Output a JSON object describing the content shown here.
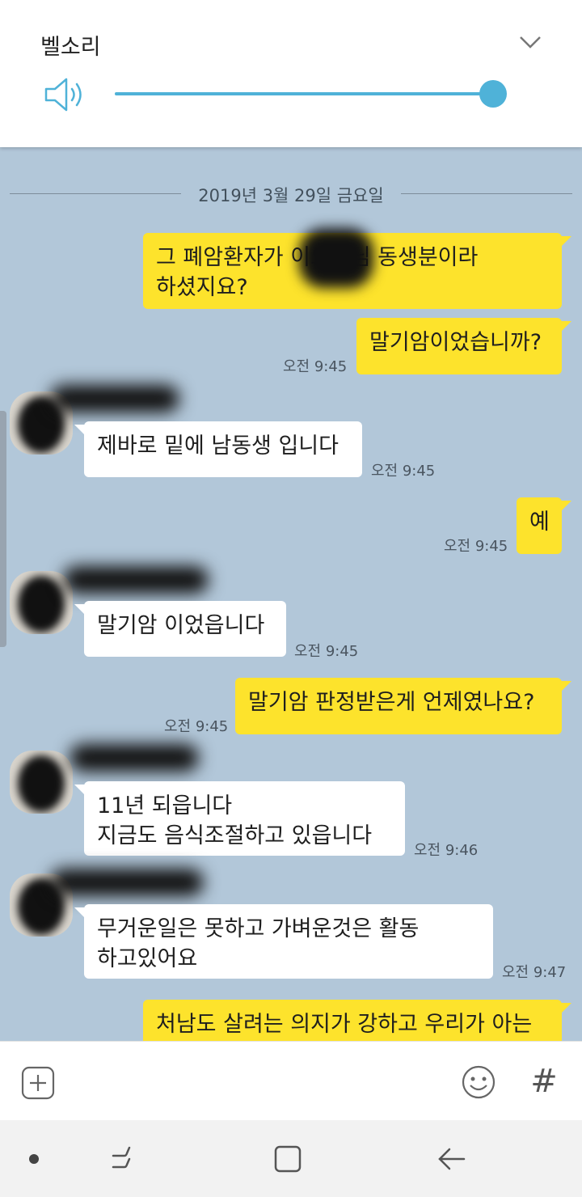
{
  "volume_panel": {
    "title": "벨소리",
    "level_percent": 100,
    "accent_color": "#4fb2d8",
    "icons": [
      "speaker-icon",
      "chevron-down-icon"
    ]
  },
  "chat": {
    "date": "2019년 3월 29일 금요일",
    "messages": [
      {
        "id": "m1",
        "sender": "me",
        "text": "그 폐암환자가 이오하님 동생분이라\n하셨지요?",
        "time": ""
      },
      {
        "id": "m2",
        "sender": "me",
        "text": "말기암이었습니까?",
        "time": "오전 9:45"
      },
      {
        "id": "m3",
        "sender": "other",
        "text": "제바로 밑에 남동생 입니다",
        "time": "오전 9:45"
      },
      {
        "id": "m4",
        "sender": "me",
        "text": "예",
        "time": "오전 9:45"
      },
      {
        "id": "m5",
        "sender": "other",
        "text": "말기암 이었읍니다",
        "time": "오전 9:45"
      },
      {
        "id": "m6",
        "sender": "me",
        "text": "말기암 판정받은게 언제였나요?",
        "time": "오전 9:45"
      },
      {
        "id": "m7",
        "sender": "other",
        "text": "11년 되읍니다\n지금도 음식조절하고  있읍니다",
        "time": "오전 9:46"
      },
      {
        "id": "m8",
        "sender": "other",
        "text": "무거운일은 못하고 가벼운것은 활동\n하고있어요",
        "time": "오전 9:47"
      },
      {
        "id": "m9",
        "sender": "me",
        "text": "처남도 살려는 의지가 강하고 우리가 아는",
        "time": ""
      }
    ],
    "bubble_colors": {
      "me": "#fde32c",
      "other": "#ffffff",
      "background": "#b2c7d9"
    }
  },
  "input_bar": {
    "icons": [
      "plus-icon",
      "emoji-icon",
      "hash-icon"
    ],
    "hash_glyph": "#"
  },
  "nav_bar": {
    "icons": [
      "dot-icon",
      "recent-apps-icon",
      "home-icon",
      "back-icon"
    ]
  }
}
